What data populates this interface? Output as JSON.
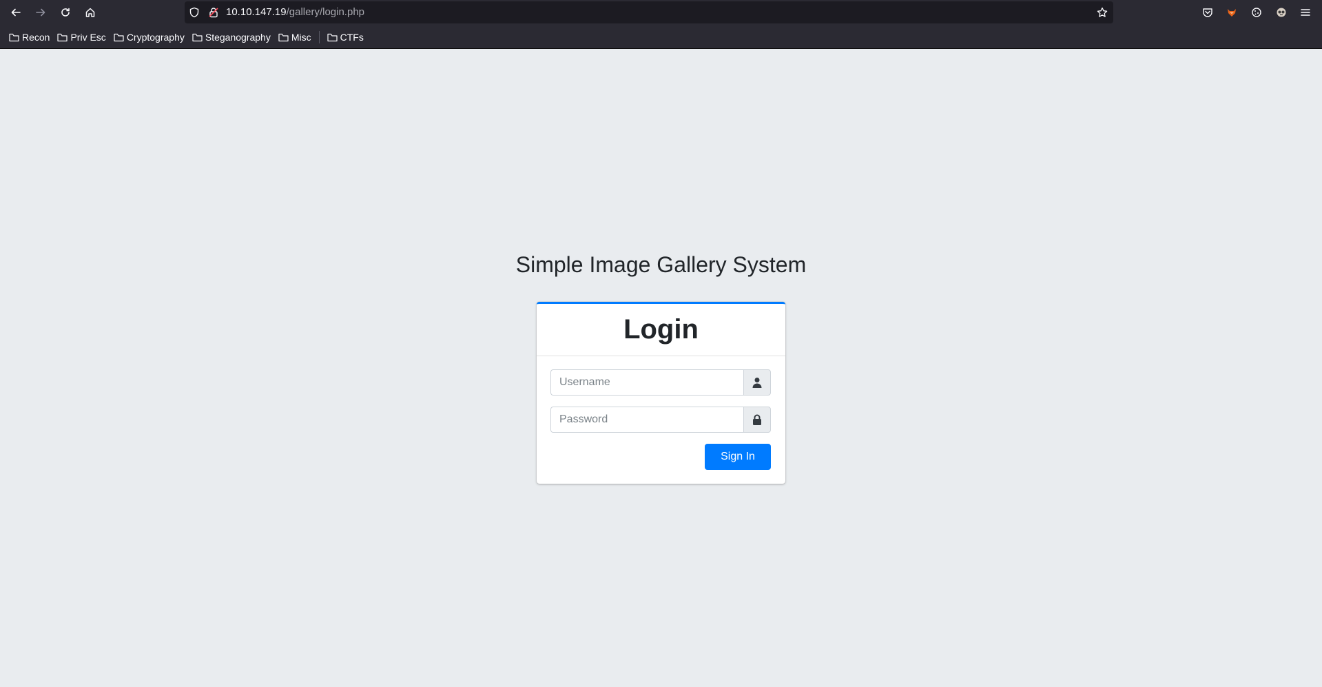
{
  "browser": {
    "url_host": "10.10.147.19",
    "url_path": "/gallery/login.php",
    "bookmarks": [
      "Recon",
      "Priv Esc",
      "Cryptography",
      "Steganography",
      "Misc",
      "CTFs"
    ]
  },
  "page": {
    "title": "Simple Image Gallery System",
    "card_title": "Login",
    "username_placeholder": "Username",
    "password_placeholder": "Password",
    "signin_label": "Sign In"
  },
  "colors": {
    "accent": "#007bff",
    "page_background": "#e9ecef",
    "chrome_background": "#2b2a33"
  }
}
